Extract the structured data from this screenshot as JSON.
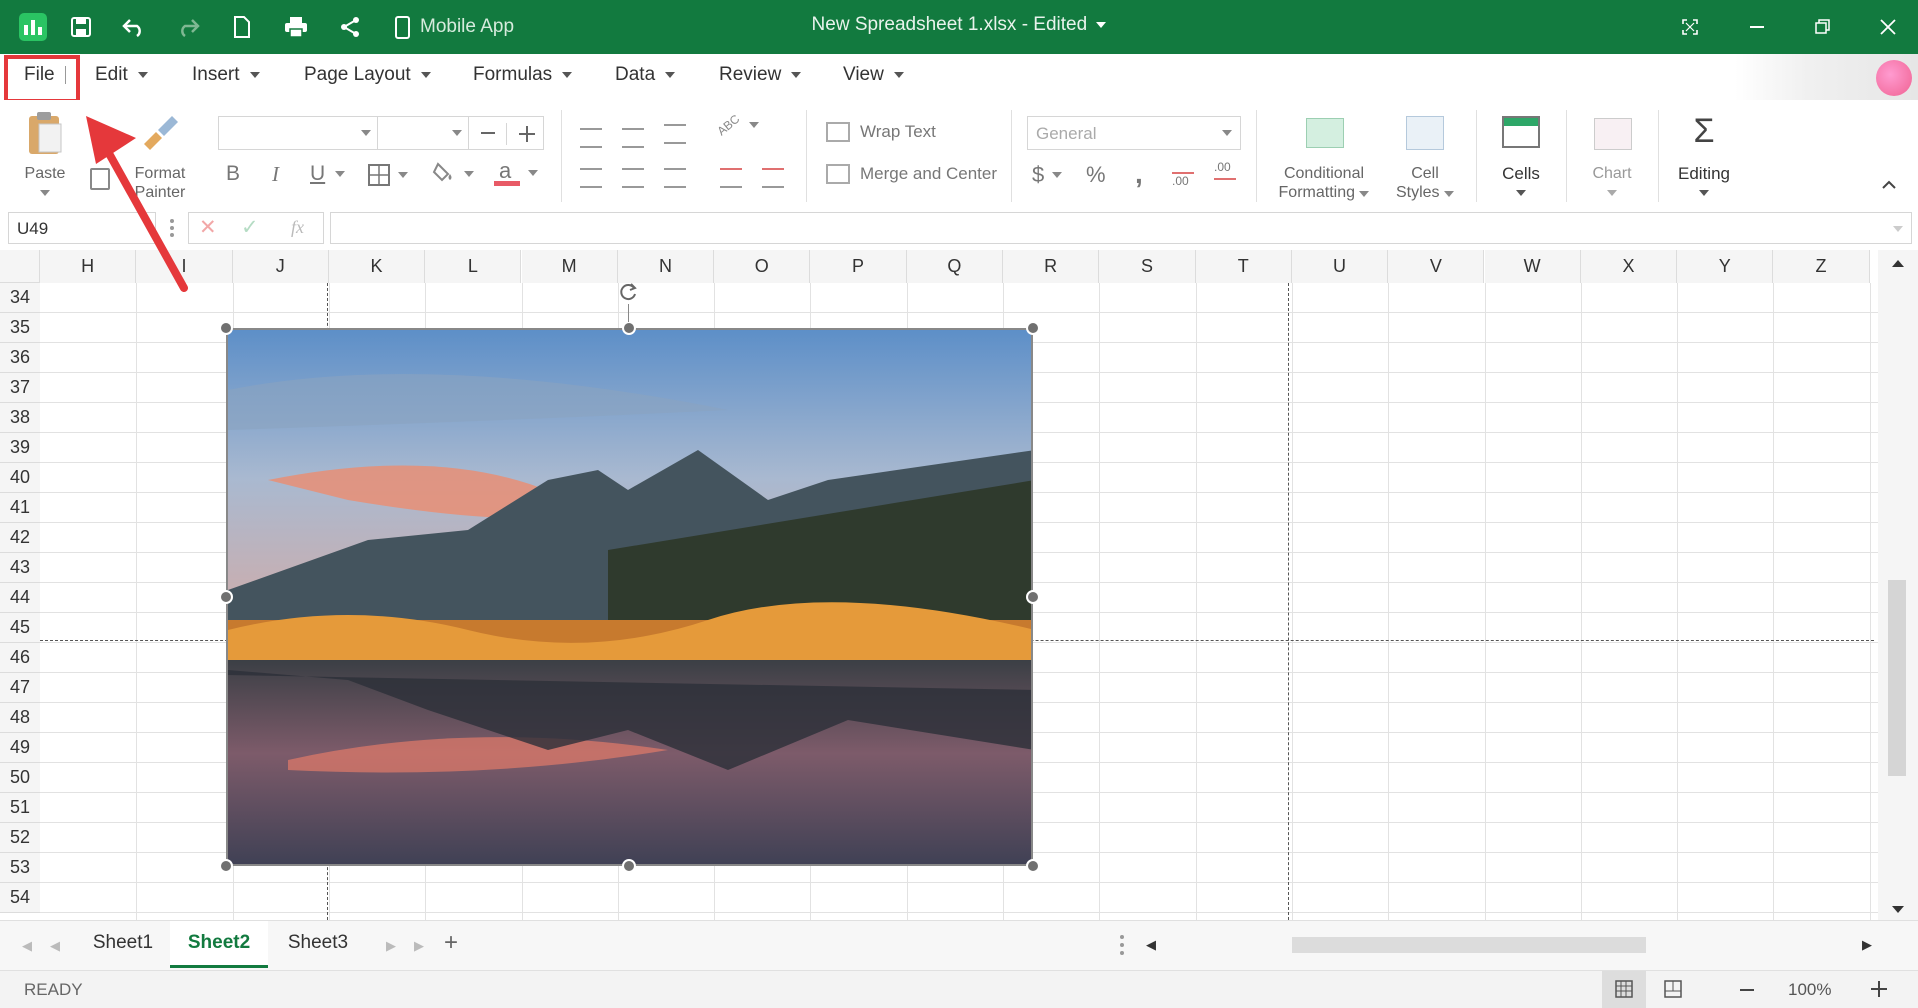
{
  "titlebar": {
    "title": "New Spreadsheet 1.xlsx - Edited",
    "mobile_label": "Mobile App"
  },
  "menu": {
    "items": [
      "File",
      "Edit",
      "Insert",
      "Page Layout",
      "Formulas",
      "Data",
      "Review",
      "View"
    ]
  },
  "toolbar": {
    "paste": "Paste",
    "format_painter_1": "Format",
    "format_painter_2": "Painter",
    "wrap_text": "Wrap Text",
    "merge_center": "Merge and Center",
    "number_format": "General",
    "percent": "%",
    "conditional_1": "Conditional",
    "conditional_2": "Formatting",
    "cell_styles_1": "Cell",
    "cell_styles_2": "Styles",
    "cells": "Cells",
    "chart": "Chart",
    "editing": "Editing",
    "dollar": "$",
    "decimal_add": ".00",
    "bold": "B",
    "italic": "I",
    "underline": "U"
  },
  "formula_bar": {
    "name_box": "U49",
    "fx": "fx",
    "formula": ""
  },
  "grid": {
    "columns": [
      "H",
      "I",
      "J",
      "K",
      "L",
      "M",
      "N",
      "O",
      "P",
      "Q",
      "R",
      "S",
      "T",
      "U",
      "V",
      "W",
      "X",
      "Y",
      "Z"
    ],
    "rows": [
      "34",
      "35",
      "36",
      "37",
      "38",
      "39",
      "40",
      "41",
      "42",
      "43",
      "44",
      "45",
      "46",
      "47",
      "48",
      "49",
      "50",
      "51",
      "52",
      "53",
      "54"
    ]
  },
  "sheets": {
    "tabs": [
      "Sheet1",
      "Sheet2",
      "Sheet3"
    ],
    "active": "Sheet2"
  },
  "status": {
    "ready": "READY",
    "zoom": "100%"
  },
  "colors": {
    "title_bar": "#127a3f",
    "annotation_red": "#e5383b",
    "active_tab_text": "#127a3f"
  }
}
